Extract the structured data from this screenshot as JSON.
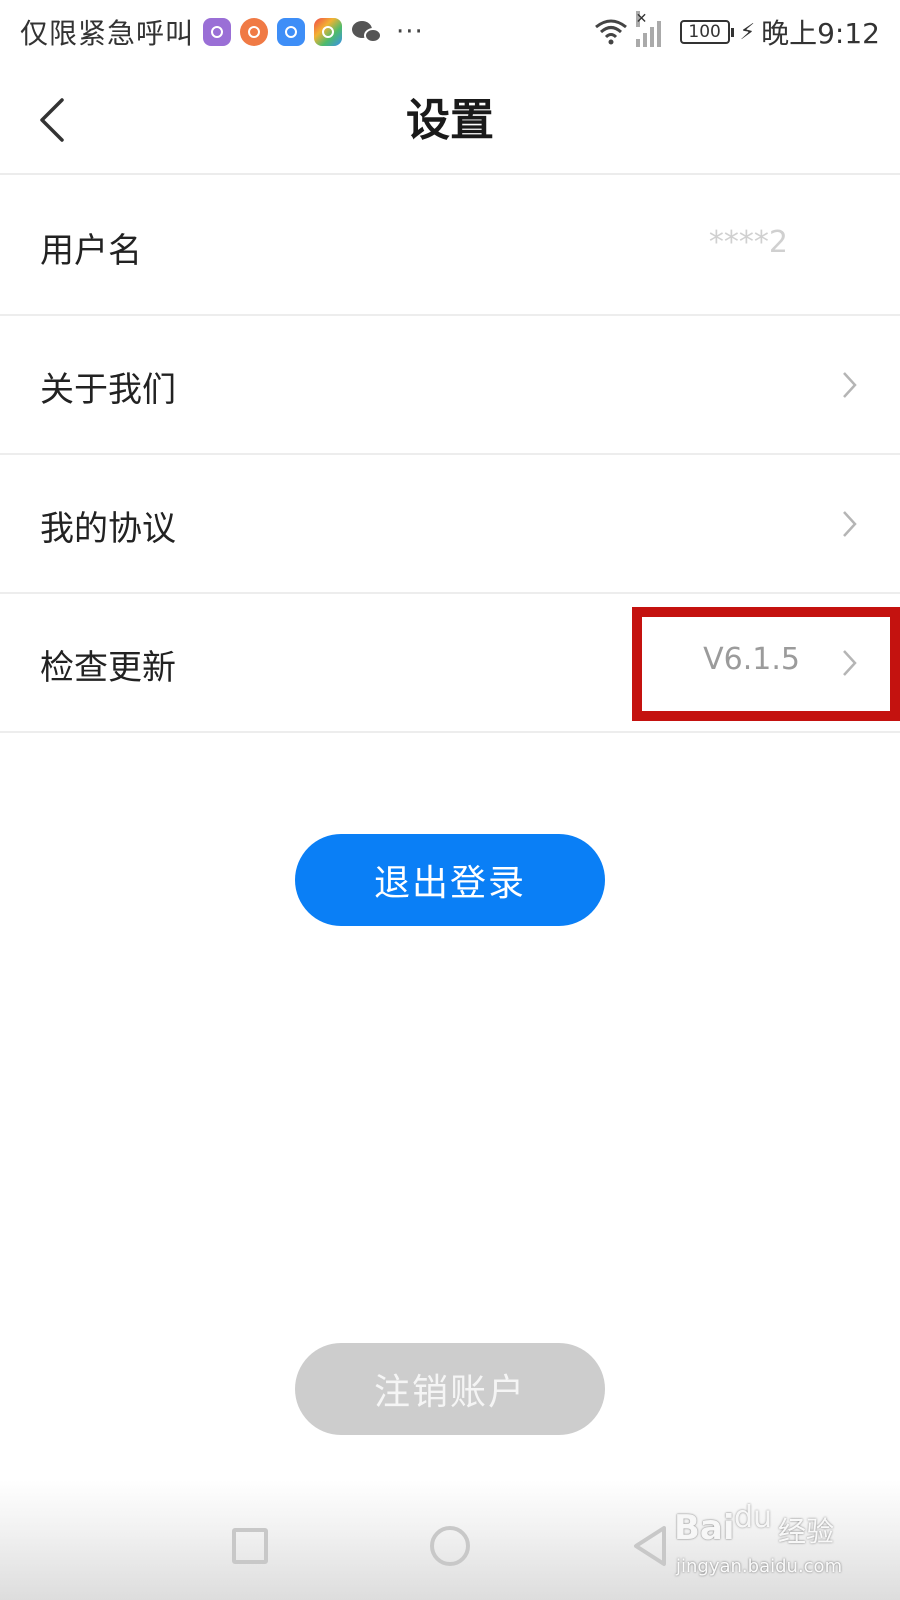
{
  "status_bar": {
    "carrier_text": "仅限紧急呼叫",
    "more": "···",
    "battery": "100",
    "time": "晚上9:12"
  },
  "header": {
    "title": "设置"
  },
  "rows": [
    {
      "label": "用户名",
      "value": "****2",
      "has_chevron": false
    },
    {
      "label": "关于我们",
      "value": "",
      "has_chevron": true
    },
    {
      "label": "我的协议",
      "value": "",
      "has_chevron": true
    },
    {
      "label": "检查更新",
      "value": "V6.1.5",
      "has_chevron": true
    }
  ],
  "buttons": {
    "logout": "退出登录",
    "cancel_account": "注销账户"
  },
  "colors": {
    "primary": "#0a7ff6",
    "disabled": "#cdcdcd",
    "highlight": "#c4120f"
  },
  "watermark": {
    "logo": "Bai",
    "paw": "du",
    "text": "经验",
    "url": "jingyan.baidu.com"
  }
}
